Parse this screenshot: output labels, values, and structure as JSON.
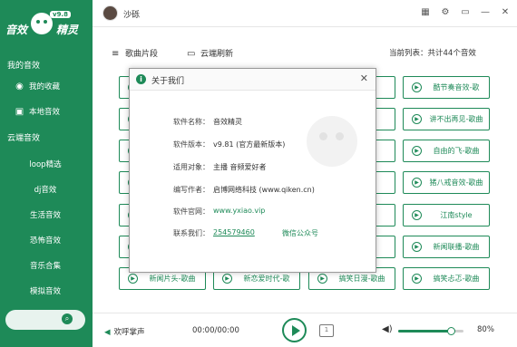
{
  "colors": {
    "brand": "#1e8a58",
    "accent": "#1e8a58"
  },
  "app": {
    "logo_text_left": "音效",
    "logo_text_right": "精灵",
    "version_badge": "v9.8"
  },
  "sidebar": {
    "section_mine": "我的音效",
    "favorites": "我的收藏",
    "local": "本地音效",
    "section_cloud": "云端音效",
    "categories": [
      "loop精选",
      "dj音效",
      "生活音效",
      "恐怖音效",
      "音乐合集",
      "模拟音效"
    ],
    "icons": {
      "favorites": "disc-icon",
      "local": "media-box-icon",
      "search": "search-icon"
    }
  },
  "topbar": {
    "username": "沙砾",
    "icons": [
      "skin-icon",
      "settings-icon",
      "minimize-window-icon",
      "minimize-icon",
      "close-icon"
    ]
  },
  "toolbar": {
    "clips_label": "歌曲片段",
    "cloud_refresh_label": "云端刷新",
    "current_list": "当前列表：共计44个音效"
  },
  "grid": [
    {
      "label": "...曲"
    },
    {
      "label": "...曲"
    },
    {
      "label": "...曲"
    },
    {
      "label": "...曲"
    },
    {
      "label": "...曲"
    },
    {
      "label": "...曲"
    },
    {
      "label": "...曲"
    },
    {
      "label": "...曲"
    },
    {
      "label": "...曲"
    },
    {
      "label": "...曲"
    },
    {
      "label": "...曲"
    },
    {
      "label": "...曲"
    },
    {
      "label": "...曲"
    },
    {
      "label": "...曲"
    },
    {
      "label": "...曲"
    },
    {
      "label": "...曲"
    },
    {
      "label": "...曲"
    },
    {
      "label": "...曲"
    },
    {
      "label": "...曲"
    },
    {
      "label": "...曲"
    },
    {
      "label": "...曲"
    },
    {
      "label": "...曲"
    },
    {
      "label": "...曲"
    },
    {
      "label": "...曲"
    },
    {
      "label": "...曲"
    },
    {
      "label": "...曲"
    },
    {
      "label": "...曲"
    },
    {
      "label": "...曲"
    },
    {
      "label": "...曲"
    },
    {
      "label": "...曲"
    },
    {
      "label": "...曲"
    },
    {
      "label": "...曲"
    },
    {
      "label": "...曲"
    },
    {
      "label": "...曲"
    },
    {
      "label": "...曲"
    },
    {
      "label": "...曲"
    },
    {
      "label": "...曲"
    },
    {
      "label": "...曲"
    },
    {
      "label": "...曲"
    },
    {
      "label": "...曲"
    }
  ],
  "grid_labels": {
    "r0": [
      "",
      "",
      "",
      "曲",
      "酷节奏音效-歌"
    ],
    "r1": [
      "",
      "",
      "",
      "",
      "讲不出再见-歌曲"
    ],
    "r2": [
      "",
      "",
      "",
      "",
      "自由的飞-歌曲"
    ],
    "r3": [
      "",
      "",
      "",
      "",
      "猪八戒音效-歌曲"
    ],
    "r4": [
      "",
      "",
      "",
      "",
      "江南style"
    ],
    "r5": [
      "",
      "",
      "",
      "",
      "新闻联播-歌曲"
    ],
    "r6": [
      "新闻片头-歌曲",
      "新恋爱时代-歌",
      "搞笑日漫-歌曲",
      "搞笑忐忑-歌曲",
      ""
    ]
  },
  "dialog": {
    "title": "关于我们",
    "name_key": "软件名称：",
    "name_val": "音效精灵",
    "version_key": "软件版本：",
    "version_val": "v9.81 (官方最新版本)",
    "target_key": "适用对象：",
    "target_val": "主播 音频爱好者",
    "author_key": "编写作者：",
    "author_val": "启博网络科技 (www.qiken.cn)",
    "site_key": "软件官网：",
    "site_val": "www.yxiao.vip",
    "contact_key": "联系我们：",
    "contact_val": "254579460",
    "wechat_val": "微信公众号"
  },
  "player": {
    "now_playing": "欢呼掌声",
    "time": "00:00/00:00",
    "volume_pct": "80%",
    "volume_fraction": 0.8
  }
}
